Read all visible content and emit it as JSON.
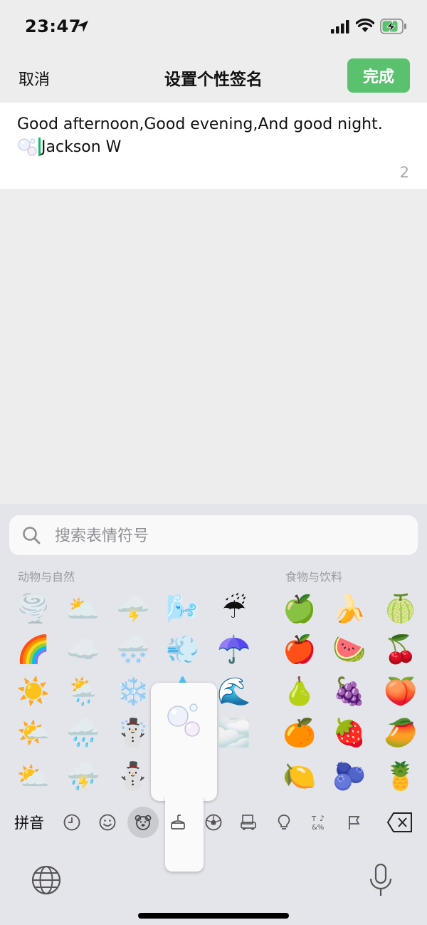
{
  "status": {
    "time": "23:47"
  },
  "nav": {
    "cancel": "取消",
    "title": "设置个性签名",
    "done": "完成"
  },
  "editor": {
    "line1": "Good afternoon,Good evening,And good night.",
    "line2_text": "Jackson W",
    "char_count": "2"
  },
  "keyboard": {
    "search_placeholder": "搜索表情符号",
    "category_animals": "动物与自然",
    "category_food": "食物与饮料",
    "pinyin": "拼音",
    "emoji_rows_left": [
      [
        "🌪️",
        "🌥️",
        "🌩️",
        "🌬️",
        "☔"
      ],
      [
        "🌈",
        "☁️",
        "🌨️",
        "💨",
        "☂️"
      ],
      [
        "☀️",
        "🌦️",
        "❄️",
        "💧",
        "🌊"
      ],
      [
        "🌤️",
        "🌧️",
        "☃️",
        "🫧",
        "🌫️"
      ],
      [
        "⛅",
        "⛈️",
        "⛄",
        "",
        ""
      ]
    ],
    "emoji_rows_right": [
      [
        "🍏",
        "🍌",
        "🍈"
      ],
      [
        "🍎",
        "🍉",
        "🍒"
      ],
      [
        "🍐",
        "🍇",
        "🍑"
      ],
      [
        "🍊",
        "🍓",
        "🥭"
      ],
      [
        "🍋",
        "🫐",
        "🍍"
      ]
    ],
    "popup_emoji": "bubbles",
    "tabs": [
      "recent-clock-icon",
      "smiley-icon",
      "animals-icon",
      "food-icon",
      "sports-icon",
      "travel-icon",
      "objects-icon",
      "symbols-icon",
      "flags-icon"
    ],
    "active_tab": "animals-icon"
  },
  "colors": {
    "accent": "#5ac26e",
    "caret": "#07c160",
    "keyboard_bg": "#e4e5ea",
    "page_bg": "#ededed"
  }
}
